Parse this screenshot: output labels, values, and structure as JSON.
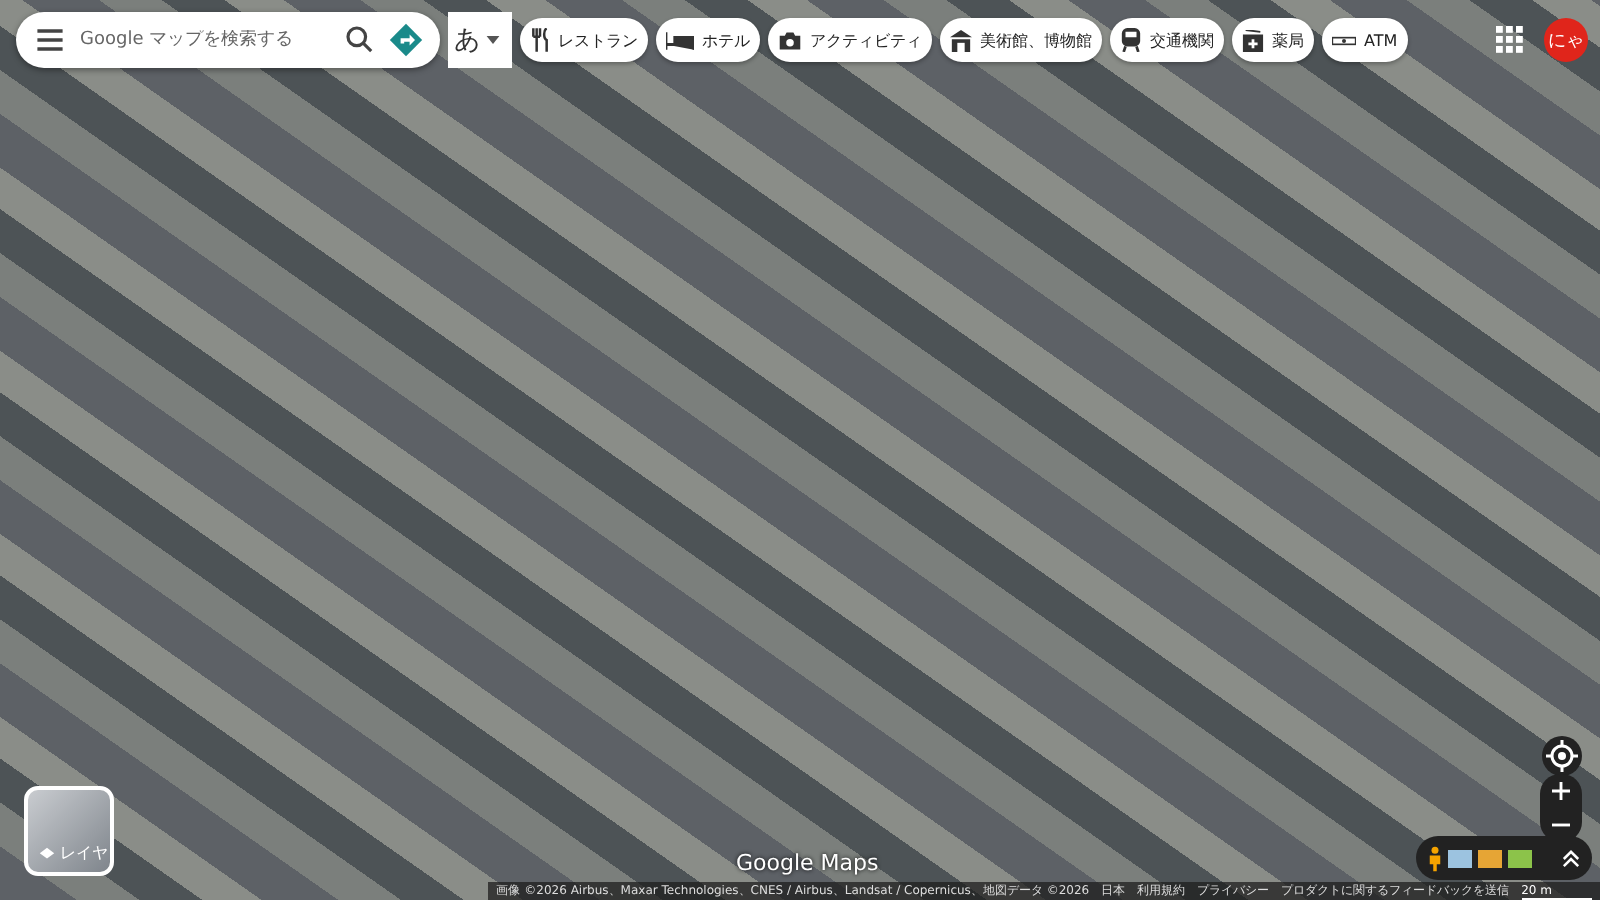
{
  "search": {
    "placeholder": "Google マップを検索する"
  },
  "input_method": {
    "label": "あ"
  },
  "chips": [
    {
      "label": "レストラン",
      "kind": "restaurant"
    },
    {
      "label": "ホテル",
      "kind": "hotel"
    },
    {
      "label": "アクティビティ",
      "kind": "activity"
    },
    {
      "label": "美術館、博物館",
      "kind": "museum"
    },
    {
      "label": "交通機関",
      "kind": "transit"
    },
    {
      "label": "薬局",
      "kind": "pharmacy"
    },
    {
      "label": "ATM",
      "kind": "atm"
    }
  ],
  "account": {
    "initials": "にゃ"
  },
  "layers": {
    "label": "レイヤ"
  },
  "logo": "Google Maps",
  "attribution": [
    "画像 ©2026 Airbus、Maxar Technologies、CNES / Airbus、Landsat / Copernicus、地図データ ©2026",
    "日本",
    "利用規約",
    "プライバシー",
    "プロダクトに関するフィードバックを送信"
  ],
  "scale": "20 m"
}
